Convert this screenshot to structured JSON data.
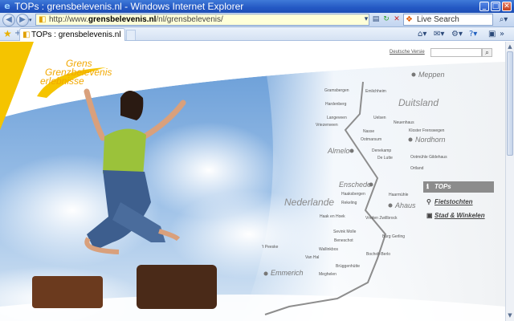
{
  "window": {
    "title": "TOPs : grensbelevenis.nl - Windows Internet Explorer",
    "minimize": "_",
    "maximize": "□",
    "close": "✕"
  },
  "addressbar": {
    "url_prefix": "http://www.",
    "url_domain": "grensbelevenis.nl",
    "url_path": "/nl/grensbelevenis/",
    "search_placeholder": "Live Search"
  },
  "tab": {
    "label": "TOPs : grensbelevenis.nl"
  },
  "site": {
    "logo_line1": "Grens",
    "logo_line2": "Grenzbelevenis",
    "logo_line3": "erlebnisse",
    "language_link": "Deutsche Versie"
  },
  "map": {
    "countries": [
      {
        "name": "Duitsland"
      },
      {
        "name": "Nederlande"
      }
    ],
    "cities": [
      {
        "name": "Meppen"
      },
      {
        "name": "Nordhorn"
      },
      {
        "name": "Almelo"
      },
      {
        "name": "Enschede"
      },
      {
        "name": "Ahaus"
      },
      {
        "name": "Emmerich"
      }
    ],
    "places": [
      "Gramsbergen",
      "Emlichheim",
      "Hardenberg",
      "Langeveen",
      "Uelsen",
      "Vriezenveen",
      "Neuenhaus",
      "Nasse",
      "Kloster Frenswegen",
      "Ootmarsum",
      "Denekamp",
      "De Lutte",
      "Ootmühle Gildehaus",
      "Ortland",
      "Haaksbergen",
      "Haarmühle",
      "Rekeling",
      "Haak en Hoek",
      "Vreden Zwillbrock",
      "Sevink Molle",
      "Beneschot",
      "Burg Gerling",
      "Wallinkbos",
      "Van Hal",
      "Bocholt-Berlo",
      "'t Peeske",
      "Brüggenhütte",
      "Meghelen"
    ]
  },
  "menu": {
    "tops": "TOPs",
    "fietstochten": "Fietstochten",
    "stad_winkelen": "Stad & Winkelen"
  }
}
